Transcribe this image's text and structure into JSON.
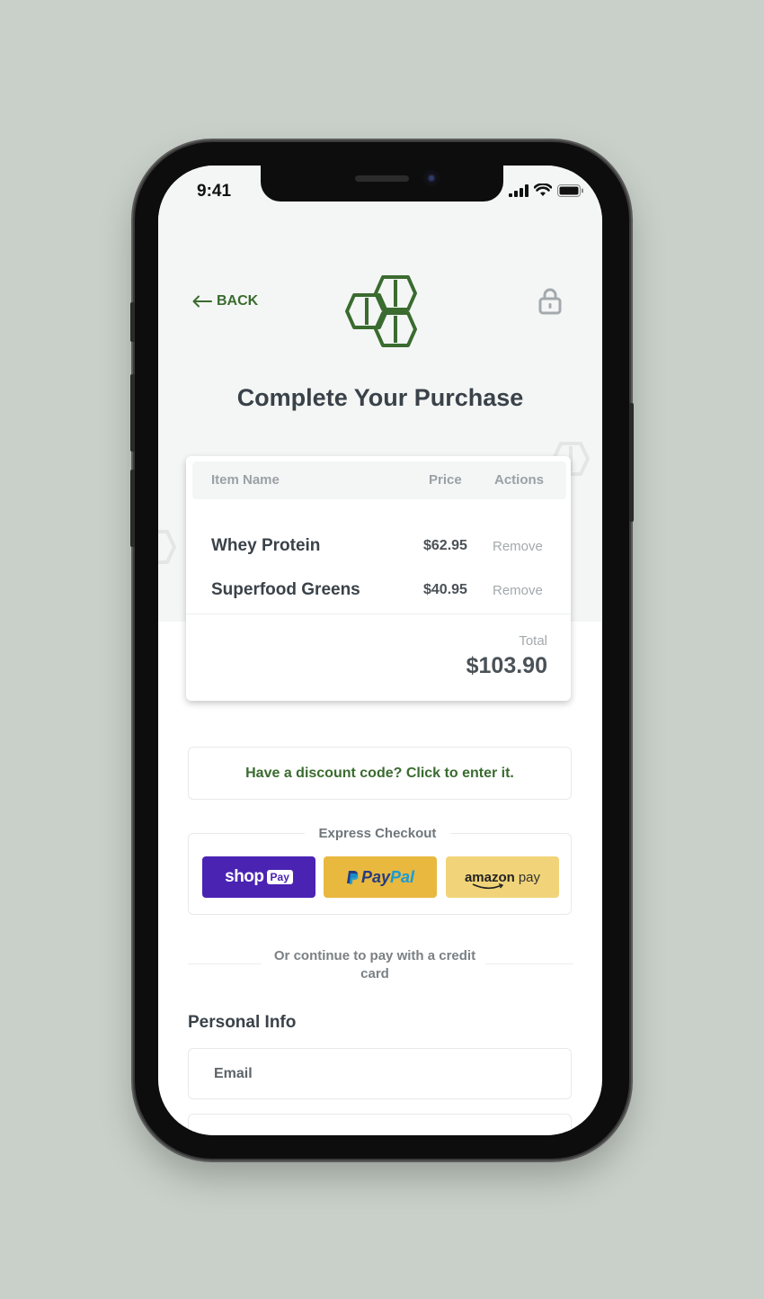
{
  "status_bar": {
    "time": "9:41"
  },
  "header": {
    "back_label": "BACK",
    "title": "Complete Your Purchase"
  },
  "cart": {
    "columns": [
      "Item Name",
      "Price",
      "Actions"
    ],
    "items": [
      {
        "name": "Whey Protein",
        "price": "$62.95",
        "action": "Remove"
      },
      {
        "name": "Superfood Greens",
        "price": "$40.95",
        "action": "Remove"
      }
    ],
    "total_label": "Total",
    "total_value": "$103.90"
  },
  "discount": {
    "label": "Have a discount code? Click to enter it."
  },
  "express": {
    "label": "Express Checkout",
    "buttons": [
      {
        "name": "shop-pay",
        "text_main": "shop",
        "text_badge": "Pay",
        "color": "#4a23b3"
      },
      {
        "name": "paypal",
        "text_main": "Pay",
        "text_accent": "Pal",
        "color": "#e8b83f"
      },
      {
        "name": "amazon-pay",
        "text_main": "amazon",
        "text_accent": "pay",
        "color": "#f1d479"
      }
    ]
  },
  "divider_text": "Or continue to pay with a credit card",
  "personal_info": {
    "title": "Personal Info",
    "email_placeholder": "Email"
  },
  "colors": {
    "brand_green": "#3a6b2f",
    "background": "#c9d0c9"
  }
}
